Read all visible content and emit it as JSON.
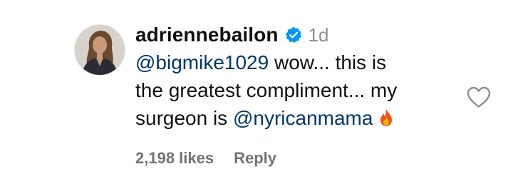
{
  "comment": {
    "username": "adriennebailon",
    "verified": true,
    "time": "1d",
    "mention_1": "@bigmike1029",
    "text_1": " wow... this is",
    "text_2": "the greatest compliment... my",
    "text_3": "surgeon is ",
    "mention_2": "@nyricanmama",
    "likes": "2,198 likes",
    "reply_label": "Reply"
  },
  "colors": {
    "mention": "#00376b",
    "verified": "#0095f6",
    "meta": "#737373"
  },
  "icons": {
    "verified": "verified-badge-icon",
    "fire": "fire-emoji-icon",
    "like": "heart-outline-icon"
  }
}
